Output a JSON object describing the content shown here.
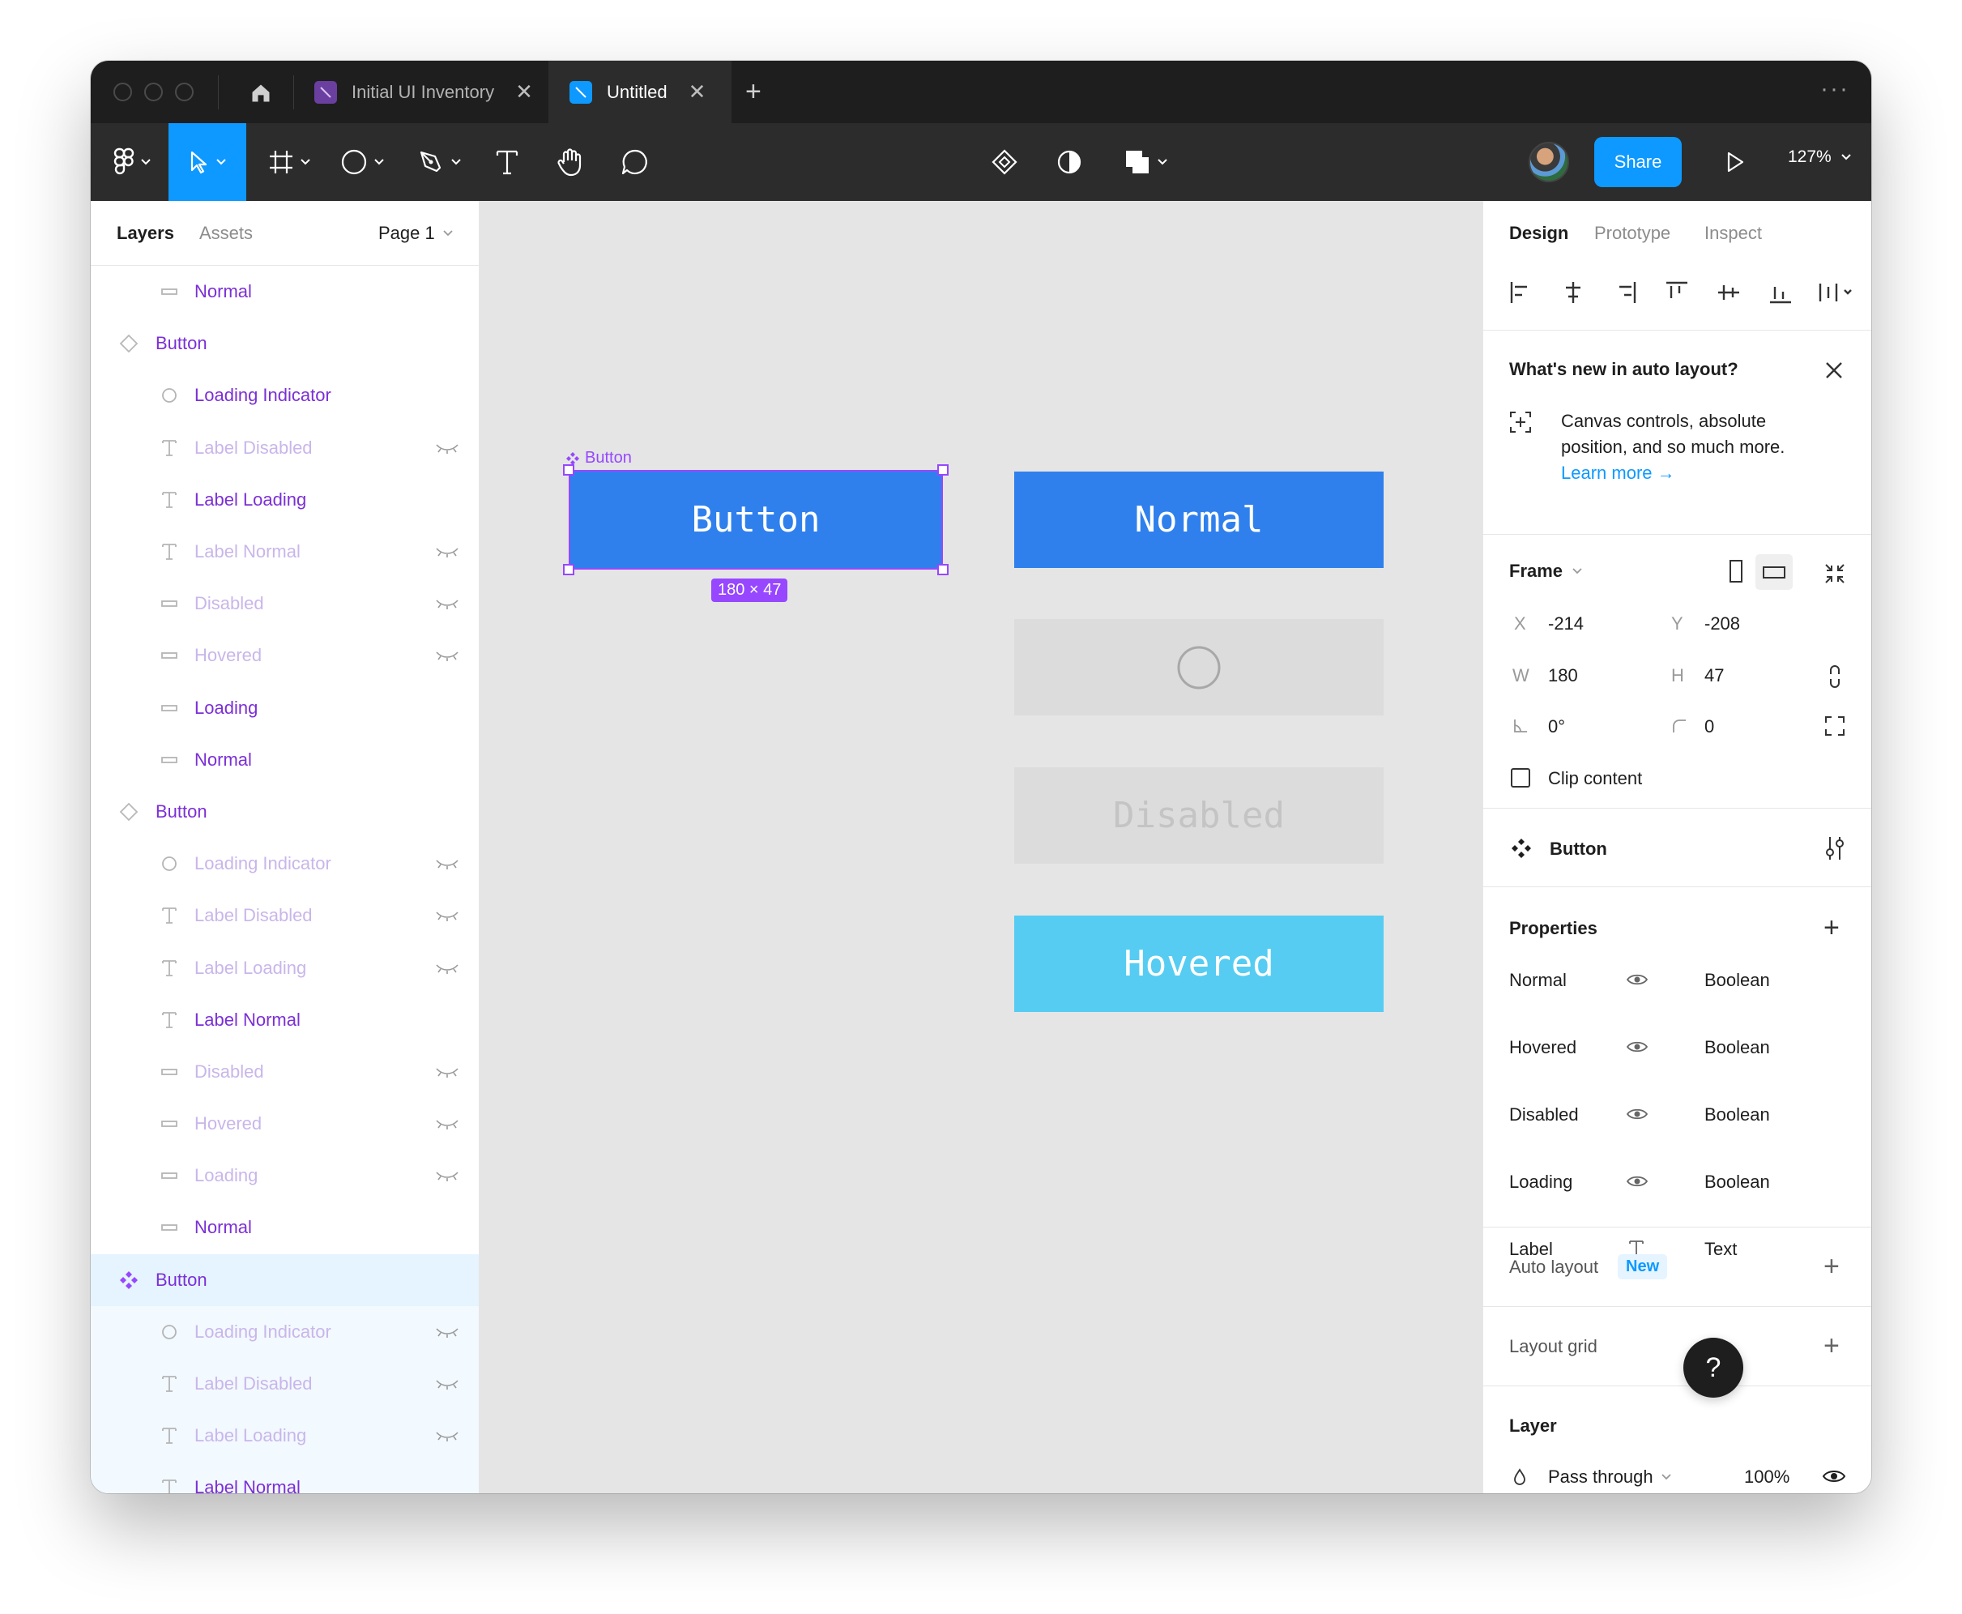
{
  "tabs": [
    {
      "label": "Initial UI Inventory",
      "close": "✕"
    },
    {
      "label": "Untitled",
      "close": "✕"
    }
  ],
  "add_tab": "+",
  "more": "···",
  "toolbar": {
    "share_label": "Share",
    "zoom": "127%"
  },
  "left_panel": {
    "tabs": [
      "Layers",
      "Assets"
    ],
    "page": "Page 1",
    "layers": [
      {
        "label": "Normal",
        "icon": "rect",
        "indent": 1,
        "style": "purple",
        "hidden": false
      },
      {
        "label": "Button",
        "icon": "variant",
        "indent": 0,
        "style": "purple",
        "hidden": false
      },
      {
        "label": "Loading Indicator",
        "icon": "ellipse",
        "indent": 1,
        "style": "purple",
        "hidden": false
      },
      {
        "label": "Label Disabled",
        "icon": "text",
        "indent": 1,
        "style": "faded",
        "hidden": true
      },
      {
        "label": "Label Loading",
        "icon": "text",
        "indent": 1,
        "style": "purple",
        "hidden": false
      },
      {
        "label": "Label Normal",
        "icon": "text",
        "indent": 1,
        "style": "faded",
        "hidden": true
      },
      {
        "label": "Disabled",
        "icon": "rect",
        "indent": 1,
        "style": "faded",
        "hidden": true
      },
      {
        "label": "Hovered",
        "icon": "rect",
        "indent": 1,
        "style": "faded",
        "hidden": true
      },
      {
        "label": "Loading",
        "icon": "rect",
        "indent": 1,
        "style": "purple",
        "hidden": false
      },
      {
        "label": "Normal",
        "icon": "rect",
        "indent": 1,
        "style": "purple",
        "hidden": false
      },
      {
        "label": "Button",
        "icon": "variant",
        "indent": 0,
        "style": "purple",
        "hidden": false
      },
      {
        "label": "Loading Indicator",
        "icon": "ellipse",
        "indent": 1,
        "style": "faded",
        "hidden": true
      },
      {
        "label": "Label Disabled",
        "icon": "text",
        "indent": 1,
        "style": "faded",
        "hidden": true
      },
      {
        "label": "Label Loading",
        "icon": "text",
        "indent": 1,
        "style": "faded",
        "hidden": true
      },
      {
        "label": "Label Normal",
        "icon": "text",
        "indent": 1,
        "style": "purple",
        "hidden": false
      },
      {
        "label": "Disabled",
        "icon": "rect",
        "indent": 1,
        "style": "faded",
        "hidden": true
      },
      {
        "label": "Hovered",
        "icon": "rect",
        "indent": 1,
        "style": "faded",
        "hidden": true
      },
      {
        "label": "Loading",
        "icon": "rect",
        "indent": 1,
        "style": "faded",
        "hidden": true
      },
      {
        "label": "Normal",
        "icon": "rect",
        "indent": 1,
        "style": "purple",
        "hidden": false
      },
      {
        "label": "Button",
        "icon": "component",
        "indent": 0,
        "style": "purple",
        "hidden": false,
        "selected": true
      },
      {
        "label": "Loading Indicator",
        "icon": "ellipse",
        "indent": 1,
        "style": "faded",
        "hidden": true,
        "selchild": true
      },
      {
        "label": "Label Disabled",
        "icon": "text",
        "indent": 1,
        "style": "faded",
        "hidden": true,
        "selchild": true
      },
      {
        "label": "Label Loading",
        "icon": "text",
        "indent": 1,
        "style": "faded",
        "hidden": true,
        "selchild": true
      },
      {
        "label": "Label Normal",
        "icon": "text",
        "indent": 1,
        "style": "purple",
        "hidden": false,
        "selchild": true
      }
    ]
  },
  "canvas": {
    "selected_label": "Button",
    "selected_button_text": "Button",
    "size_badge": "180 × 47",
    "variants": [
      {
        "text": "Normal",
        "bg": "#2f80ed",
        "color": "#ffffff"
      },
      {
        "text": "",
        "bg": "#dcdcdc",
        "color": "#a8a8a8",
        "spinner": true
      },
      {
        "text": "Disabled",
        "bg": "#dcdcdc",
        "color": "#c4c4c4"
      },
      {
        "text": "Hovered",
        "bg": "#56ccf2",
        "color": "#ffffff"
      }
    ]
  },
  "right_panel": {
    "tabs": [
      "Design",
      "Prototype",
      "Inspect"
    ],
    "whats_new": {
      "title": "What's new in auto layout?",
      "body_line1": "Canvas controls, absolute",
      "body_line2": "position, and so much more.",
      "link": "Learn more →"
    },
    "frame": {
      "title": "Frame",
      "x_label": "X",
      "x": "-214",
      "y_label": "Y",
      "y": "-208",
      "w_label": "W",
      "w": "180",
      "h_label": "H",
      "h": "47",
      "rotation": "0°",
      "radius": "0",
      "clip_content": "Clip content"
    },
    "component": {
      "name": "Button"
    },
    "properties": {
      "title": "Properties",
      "rows": [
        {
          "name": "Normal",
          "type": "Boolean",
          "icon": "eye"
        },
        {
          "name": "Hovered",
          "type": "Boolean",
          "icon": "eye"
        },
        {
          "name": "Disabled",
          "type": "Boolean",
          "icon": "eye"
        },
        {
          "name": "Loading",
          "type": "Boolean",
          "icon": "eye"
        },
        {
          "name": "Label",
          "type": "Text",
          "icon": "text"
        }
      ]
    },
    "auto_layout": {
      "title": "Auto layout",
      "badge": "New"
    },
    "layout_grid": {
      "title": "Layout grid"
    },
    "layer": {
      "title": "Layer",
      "blend": "Pass through",
      "opacity": "100%"
    },
    "help": "?"
  },
  "colors": {
    "accent": "#0d99ff",
    "component_purple": "#9747ff",
    "layer_purple": "#7b2fd6"
  }
}
